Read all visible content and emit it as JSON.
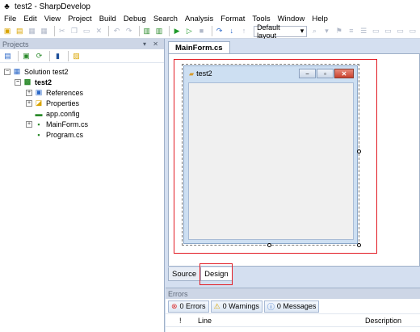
{
  "window": {
    "title": "test2 - SharpDevelop"
  },
  "menu": [
    "File",
    "Edit",
    "View",
    "Project",
    "Build",
    "Debug",
    "Search",
    "Analysis",
    "Format",
    "Tools",
    "Window",
    "Help"
  ],
  "toolbar": {
    "layout_combo": "Default layout"
  },
  "projects": {
    "title": "Projects",
    "header_controls": "▾ ✕",
    "tree": {
      "solution": "Solution test2",
      "project": "test2",
      "items": [
        "References",
        "Properties",
        "app.config",
        "MainForm.cs",
        "Program.cs"
      ]
    }
  },
  "document": {
    "tab": "MainForm.cs",
    "form_title": "test2",
    "view_tabs": [
      "Source",
      "Design"
    ]
  },
  "errors": {
    "title": "Errors",
    "filters": {
      "errors": "0 Errors",
      "warnings": "0 Warnings",
      "messages": "0 Messages"
    },
    "columns": {
      "bang": "!",
      "line": "Line",
      "description": "Description"
    }
  },
  "colors": {
    "highlight": "#e21b23",
    "pane_header": "#cdd6e6",
    "form_bg": "#cddff2"
  }
}
